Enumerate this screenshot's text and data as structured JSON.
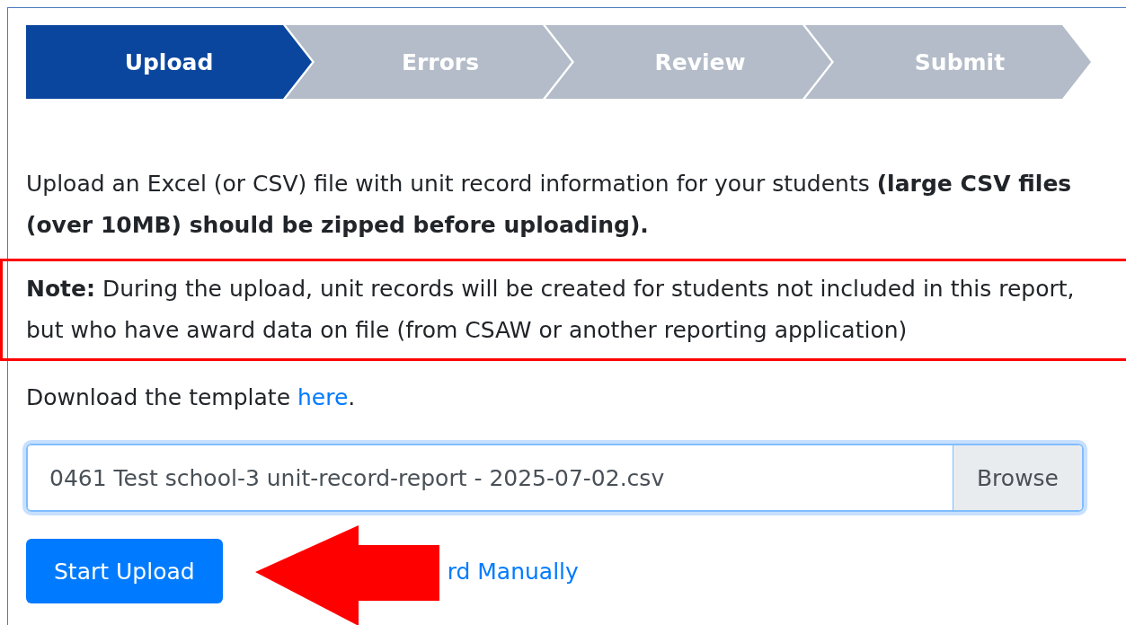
{
  "steps": [
    {
      "label": "Upload",
      "selected": true
    },
    {
      "label": "Errors",
      "selected": false
    },
    {
      "label": "Review",
      "selected": false
    },
    {
      "label": "Submit",
      "selected": false
    }
  ],
  "intro": "Upload an Excel (or CSV) file with unit record information for your students **(large CSV files (over 10MB) should be zipped before uploading).**",
  "note": "**Note:** During the upload, unit records will be created for students not included in this report, but who have award data on file (from CSAW or another reporting application)",
  "download": {
    "text": "Download the template ",
    "link": "here",
    "end": "."
  },
  "file_input": {
    "value": "0461 Test school-3 unit-record-report - 2025-07-02.csv",
    "button": "Browse"
  },
  "start_button": "Start Upload",
  "manual_link": "rd Manually"
}
